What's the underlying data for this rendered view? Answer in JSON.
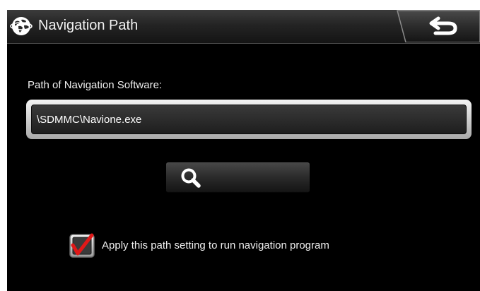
{
  "header": {
    "title": "Navigation Path",
    "app_icon": "globe-icon",
    "back_icon": "back-arrow-icon"
  },
  "main": {
    "path_label": "Path of Navigation Software:",
    "path_value": "\\SDMMC\\Navione.exe",
    "search_icon": "search-icon",
    "apply_checkbox": {
      "label": "Apply this path setting to run navigation program",
      "checked": true
    }
  },
  "colors": {
    "background": "#000000",
    "title_bar": "#2a2a2a",
    "check_mark": "#e01818",
    "text": "#f0f0f0"
  }
}
